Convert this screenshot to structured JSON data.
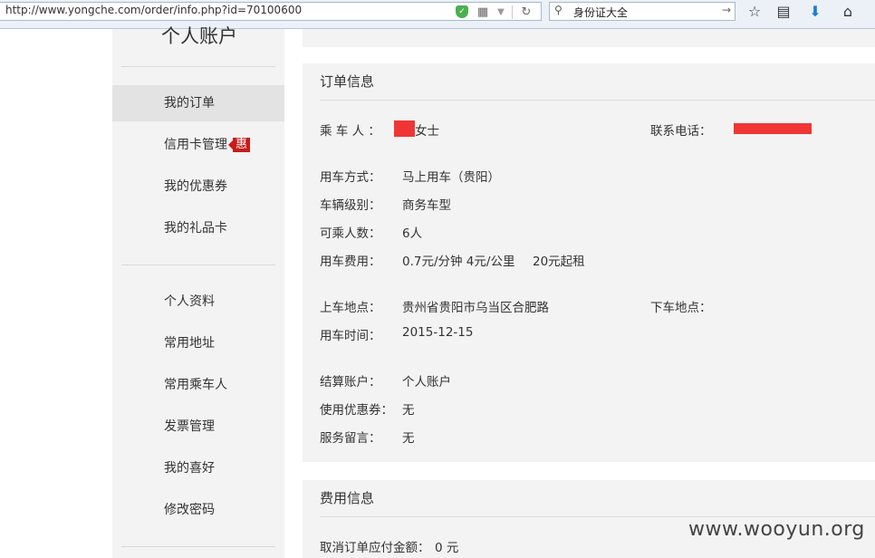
{
  "browser": {
    "url": "http://www.yongche.com/order/info.php?id=70100600",
    "search_query": "身份证大全"
  },
  "sidebar": {
    "title": "个人账户",
    "group1": [
      {
        "label": "我的订单",
        "active": true
      },
      {
        "label": "信用卡管理",
        "badge": "惠"
      },
      {
        "label": "我的优惠券"
      },
      {
        "label": "我的礼品卡"
      }
    ],
    "group2": [
      {
        "label": "个人资料"
      },
      {
        "label": "常用地址"
      },
      {
        "label": "常用乘车人"
      },
      {
        "label": "发票管理"
      },
      {
        "label": "我的喜好"
      },
      {
        "label": "修改密码"
      }
    ]
  },
  "order": {
    "title": "订单信息",
    "passenger_label": "乘 车 人 ：",
    "passenger_value": "女士",
    "phone_label": "联系电话：",
    "mode_label": "用车方式：",
    "mode_value": "马上用车（贵阳）",
    "level_label": "车辆级别：",
    "level_value": "商务车型",
    "seats_label": "可乘人数：",
    "seats_value": "6人",
    "fee_label": "用车费用：",
    "fee_value": "0.7元/分钟 4元/公里",
    "fee_min": "20元起租",
    "pickup_label": "上车地点：",
    "pickup_value": "贵州省贵阳市乌当区合肥路",
    "dropoff_label": "下车地点：",
    "time_label": "用车时间：",
    "time_value": "2015-12-15",
    "account_label": "结算账户：",
    "account_value": "个人账户",
    "coupon_label": "使用优惠券：",
    "coupon_value": "无",
    "note_label": "服务留言：",
    "note_value": "无"
  },
  "fee": {
    "title": "费用信息",
    "cancel_label": "取消订单应付金额：",
    "cancel_value": "0 元"
  },
  "watermark": "www.wooyun.org",
  "colors": {
    "redaction": "#f03535",
    "badge": "#c91b1b",
    "panel_bg": "#f3f3f3"
  }
}
